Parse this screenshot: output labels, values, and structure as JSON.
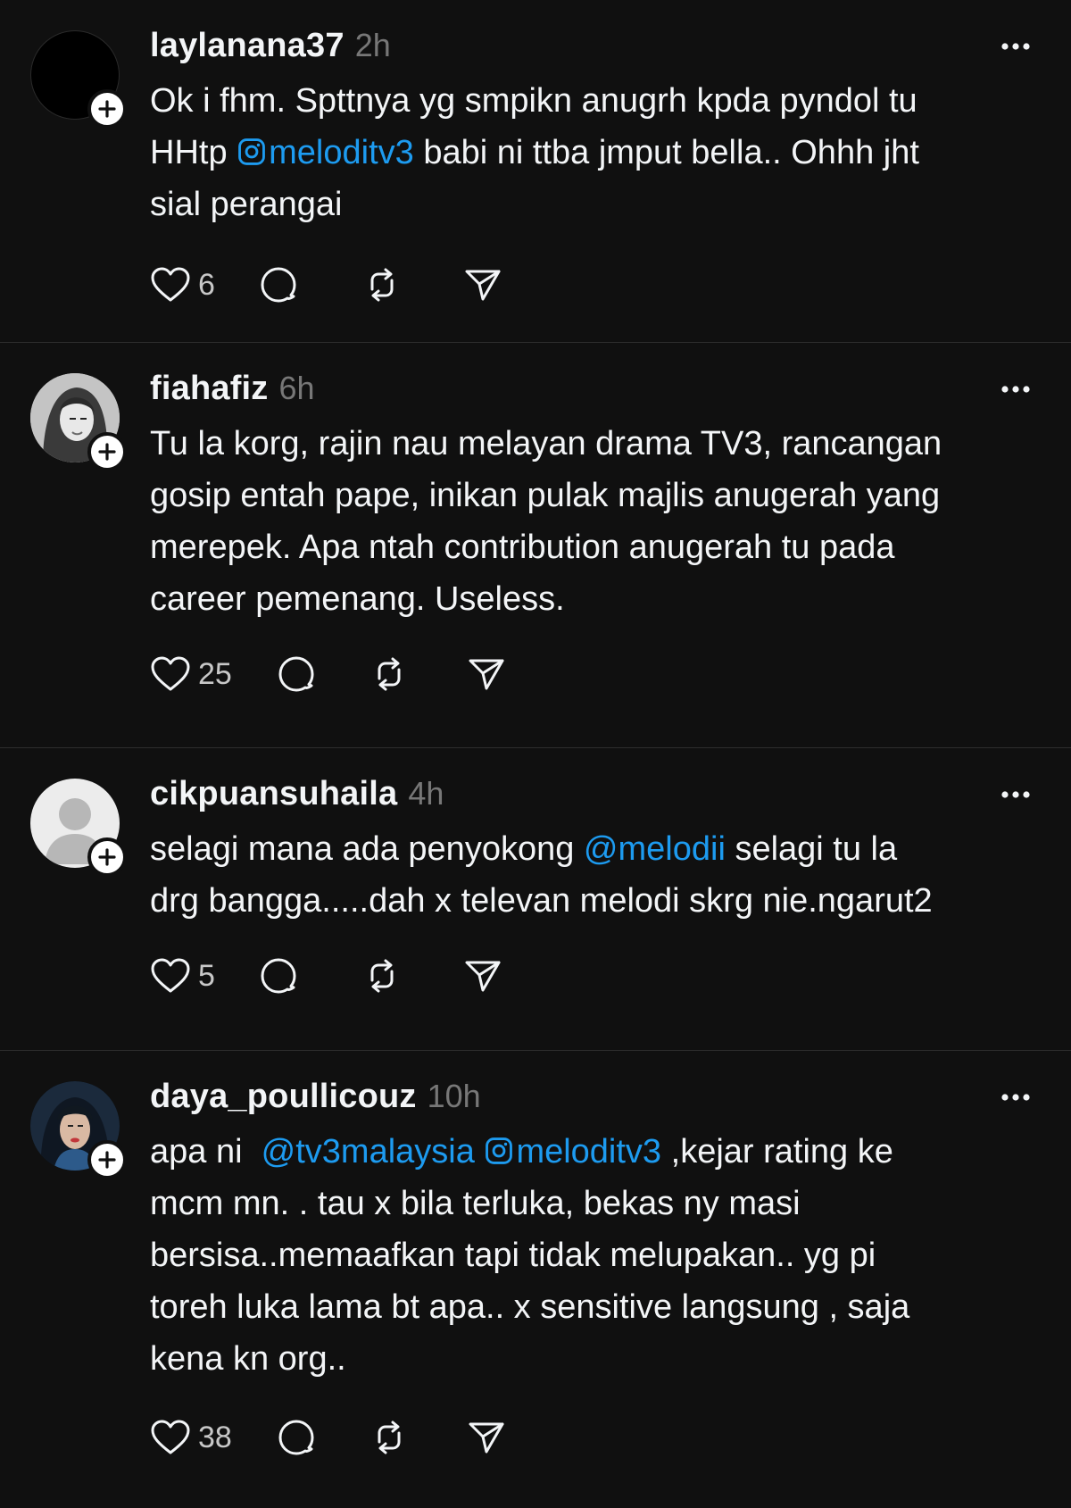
{
  "colors": {
    "background": "#101010",
    "text": "#f3f5f7",
    "muted": "#777777",
    "mention": "#1d9bf0",
    "divider": "#2d2d2d"
  },
  "posts": [
    {
      "username": "laylanana37",
      "time": "2h",
      "avatar": "black-circle",
      "text": [
        "Ok i fhm. Spttnya yg smpikn anugrh kpda pyndol tu",
        "HHtp ",
        "meloditv3",
        " babi ni ttba jmput bella.. Ohhh jht",
        "sial perangai"
      ],
      "likes": "6"
    },
    {
      "username": "fiahafiz",
      "time": "6h",
      "avatar": "photo",
      "text": [
        "Tu la korg, rajin nau melayan drama TV3, rancangan",
        "gosip entah pape, inikan pulak majlis anugerah yang",
        "merepek. Apa ntah contribution anugerah tu pada",
        "career pemenang. Useless."
      ],
      "likes": "25"
    },
    {
      "username": "cikpuansuhaila",
      "time": "4h",
      "avatar": "default-silhouette",
      "text": [
        "selagi mana ada penyokong ",
        "@melodii",
        " selagi tu la",
        "drg bangga.....dah x televan melodi skrg nie.ngarut2"
      ],
      "likes": "5"
    },
    {
      "username": "daya_poullicouz",
      "time": "10h",
      "avatar": "photo",
      "text": [
        "apa ni  ",
        "@tv3malaysia",
        "meloditv3",
        " ,kejar rating ke",
        "mcm mn. . tau x bila terluka, bekas ny masi",
        "bersisa..memaafkan tapi tidak melupakan.. yg pi",
        "toreh luka lama bt apa.. x sensitive langsung , saja",
        "kena kn org.."
      ],
      "likes": "38"
    }
  ]
}
